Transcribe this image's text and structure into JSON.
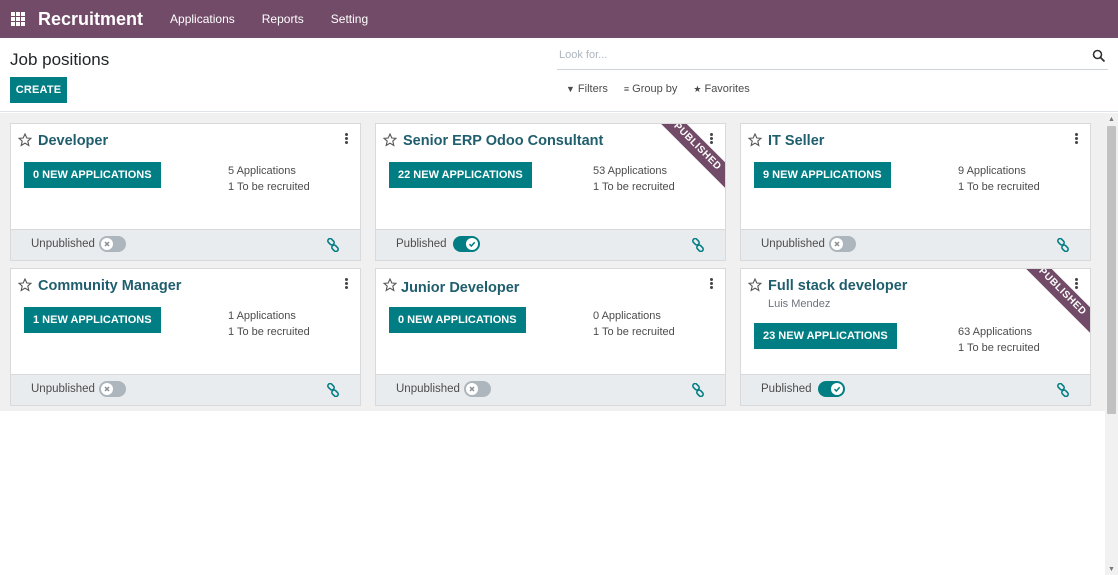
{
  "navbar": {
    "brand": "Recruitment",
    "menu": [
      "Applications",
      "Reports",
      "Setting"
    ]
  },
  "control_panel": {
    "title": "Job positions",
    "create_label": "CREATE",
    "search_placeholder": "Look for...",
    "filters_label": "Filters",
    "groupby_label": "Group by",
    "favorites_label": "Favorites"
  },
  "cards": [
    {
      "title": "Developer",
      "subtitle": "",
      "new_apps": "0 NEW APPLICATIONS",
      "applications": "5 Applications",
      "to_recruit": "1 To be recruited",
      "status": "Unpublished",
      "published": false,
      "ribbon": ""
    },
    {
      "title": "Senior ERP Odoo Consultant",
      "subtitle": "",
      "new_apps": "22 NEW APPLICATIONS",
      "applications": "53 Applications",
      "to_recruit": "1 To be recruited",
      "status": "Published",
      "published": true,
      "ribbon": "PUBLISHED"
    },
    {
      "title": "IT Seller",
      "subtitle": "",
      "new_apps": "9 NEW APPLICATIONS",
      "applications": "9 Applications",
      "to_recruit": "1 To be recruited",
      "status": "Unpublished",
      "published": false,
      "ribbon": ""
    },
    {
      "title": "Community Manager",
      "subtitle": "",
      "new_apps": "1 NEW APPLICATIONS",
      "applications": "1 Applications",
      "to_recruit": "1 To be recruited",
      "status": "Unpublished",
      "published": false,
      "ribbon": ""
    },
    {
      "title": "Junior Developer",
      "subtitle": "",
      "new_apps": "0 NEW APPLICATIONS",
      "applications": "0 Applications",
      "to_recruit": "1 To be recruited",
      "status": "Unpublished",
      "published": false,
      "ribbon": ""
    },
    {
      "title": "Full stack developer",
      "subtitle": "Luis Mendez",
      "new_apps": "23 NEW APPLICATIONS",
      "applications": "63 Applications",
      "to_recruit": "1 To be recruited",
      "status": "Published",
      "published": true,
      "ribbon": "PUBLISHED"
    }
  ],
  "colors": {
    "brand": "#714b67",
    "primary": "#017e84"
  }
}
